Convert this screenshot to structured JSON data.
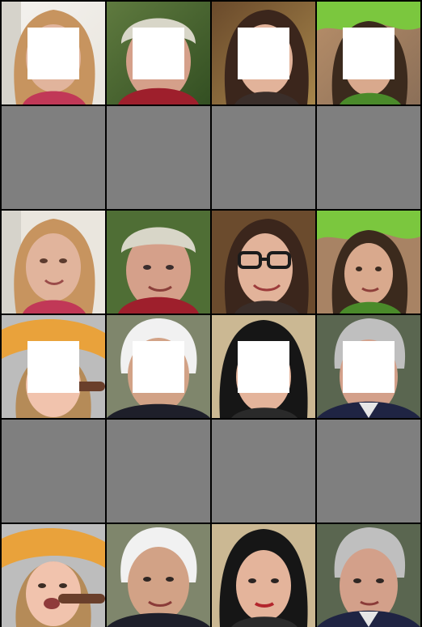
{
  "grid": {
    "columns": 4,
    "rows": 6,
    "mask_color": "#ffffff",
    "placeholder_color": "#7f7f7f",
    "row_types": [
      "masked",
      "placeholder",
      "full",
      "masked",
      "placeholder",
      "full"
    ]
  },
  "faces": [
    {
      "subject": "young-woman-blonde",
      "bg": "#e9e5dd",
      "bg2": "#f4f2ef",
      "hair": "#c7945f",
      "skin": "#e1b49c",
      "shirt": "#c13857",
      "accessory": ""
    },
    {
      "subject": "older-man-cap",
      "bg": "#5f7a3f",
      "bg2": "#334f22",
      "hair": "#d8d6c8",
      "skin": "#d5a08a",
      "shirt": "#9e1f2c",
      "accessory": "cap"
    },
    {
      "subject": "woman-glasses",
      "bg": "#6a4a2b",
      "bg2": "#a7864b",
      "hair": "#3b261c",
      "skin": "#e2b39a",
      "shirt": "#3a2e2a",
      "accessory": "glasses"
    },
    {
      "subject": "woman-leaf-hat",
      "bg": "#b88f69",
      "bg2": "#8b6f58",
      "hair": "#3b2a1d",
      "skin": "#d9a98d",
      "shirt": "#4a8a2a",
      "accessory": "leaf-hat"
    },
    {
      "subject": "graduate-girl",
      "bg": "#e9a23b",
      "bg2": "#bcbcbc",
      "hair": "#b58b58",
      "skin": "#f1c3ad",
      "shirt": "#e79c3b",
      "accessory": "grad-cap"
    },
    {
      "subject": "older-man-white-hair",
      "bg": "#8a8f77",
      "bg2": "#707a5b",
      "hair": "#f1f1f1",
      "skin": "#d2a286",
      "shirt": "#1e1f2a",
      "accessory": ""
    },
    {
      "subject": "woman-dark-hair",
      "bg": "#d8c8a6",
      "bg2": "#b59c72",
      "hair": "#161616",
      "skin": "#e4b49b",
      "shirt": "#2a2a2a",
      "accessory": ""
    },
    {
      "subject": "man-gray-hair-suit",
      "bg": "#4f5f49",
      "bg2": "#6f6b47",
      "hair": "#bfbfbf",
      "skin": "#d3a08a",
      "shirt": "#1f2443",
      "accessory": ""
    }
  ]
}
